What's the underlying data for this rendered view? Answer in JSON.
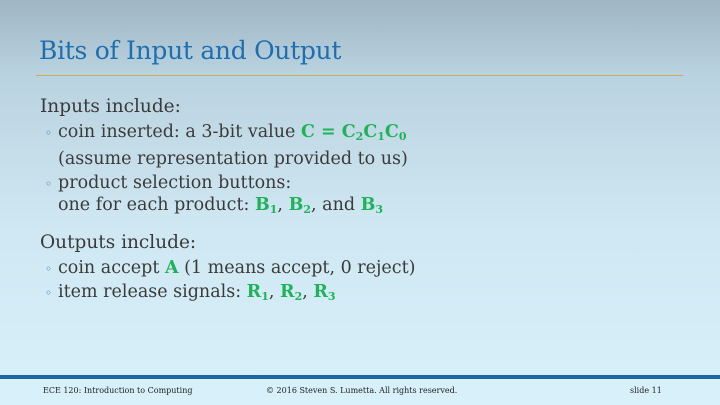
{
  "title": "Bits of Input and Output",
  "inputs": {
    "heading": "Inputs include:",
    "coin": {
      "text": "coin inserted: a 3-bit value ",
      "var": "C = C",
      "s2": "2",
      "c1": "C",
      "s1": "1",
      "c0": "C",
      "s0": "0",
      "line2": "(assume representation provided to us)"
    },
    "buttons": {
      "line1": "product selection buttons:",
      "line2_prefix": "one for each product: ",
      "b": "B",
      "s1": "1",
      "s2": "2",
      "s3": "3",
      "sep1": ", ",
      "sep2": ", and "
    }
  },
  "outputs": {
    "heading": "Outputs include:",
    "accept": {
      "prefix": "coin accept ",
      "var": "A",
      "suffix": " (1 means accept, 0 reject)"
    },
    "release": {
      "prefix": "item release signals: ",
      "r": "R",
      "s1": "1",
      "s2": "2",
      "s3": "3",
      "sep": ", "
    }
  },
  "bullet_glyph": "◦",
  "footer": {
    "left": "ECE 120: Introduction to Computing",
    "center": "© 2016 Steven S. Lumetta.  All rights reserved.",
    "right": "slide 11"
  },
  "colors": {
    "title": "#1e6fb0",
    "accent_green": "#20b25a",
    "rule": "#c7ae55",
    "footer_bar": "#1d66a6"
  }
}
